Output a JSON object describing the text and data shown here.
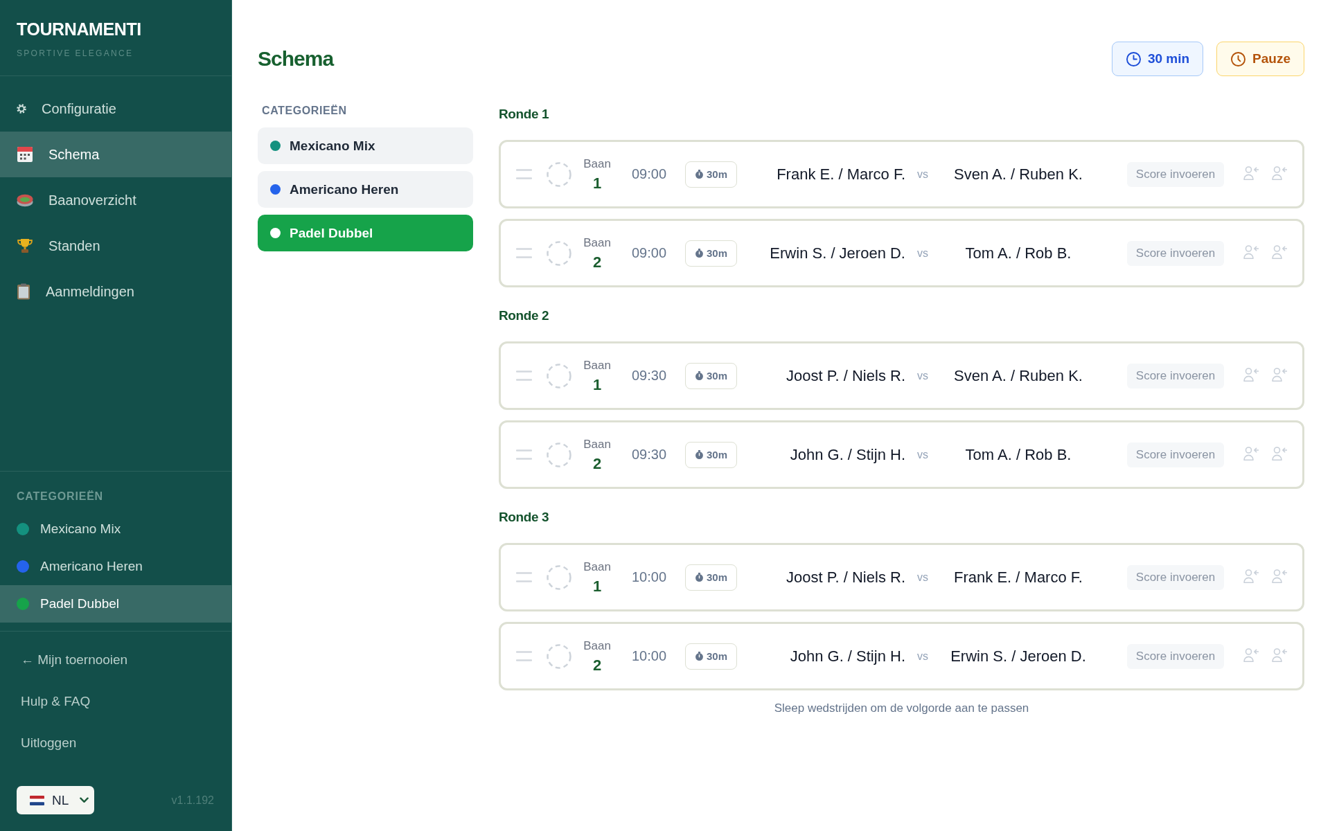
{
  "sidebar": {
    "brand": {
      "name": "TOURNAMENTI",
      "tagline": "SPORTIVE ELEGANCE"
    },
    "nav": [
      {
        "label": "Configuratie",
        "selected": false
      },
      {
        "label": "Schema",
        "selected": true
      },
      {
        "label": "Baanoverzicht",
        "selected": false
      },
      {
        "label": "Standen",
        "selected": false
      },
      {
        "label": "Aanmeldingen",
        "selected": false
      }
    ],
    "categories_heading": "CATEGORIEËN",
    "categories": [
      {
        "label": "Mexicano Mix",
        "color": "#14917f",
        "selected": false
      },
      {
        "label": "Americano Heren",
        "color": "#2563eb",
        "selected": false
      },
      {
        "label": "Padel Dubbel",
        "color": "#16a34a",
        "selected": true
      }
    ],
    "links": [
      "← Mijn toernooien",
      "Hulp & FAQ",
      "Uitloggen"
    ],
    "language": "NL",
    "version": "v1.1.192"
  },
  "header": {
    "title": "Schema",
    "buttons": [
      {
        "label": "30 min",
        "kind": "duration"
      },
      {
        "label": "Pauze",
        "kind": "pause"
      }
    ]
  },
  "category_panel": {
    "heading": "CATEGORIEËN",
    "items": [
      {
        "label": "Mexicano Mix",
        "color": "#14917f",
        "selected": false
      },
      {
        "label": "Americano Heren",
        "color": "#2563eb",
        "selected": false
      },
      {
        "label": "Padel Dubbel",
        "color": "#16a34a",
        "selected": true
      }
    ]
  },
  "rounds": [
    {
      "title": "Ronde 1",
      "matches": [
        {
          "court_label": "Baan",
          "court": "1",
          "time": "09:00",
          "duration": "30m",
          "team_1": "Frank E. / Marco F.",
          "vs": "vs",
          "team_2": "Sven A. / Ruben K.",
          "score_button": "Score invoeren"
        },
        {
          "court_label": "Baan",
          "court": "2",
          "time": "09:00",
          "duration": "30m",
          "team_1": "Erwin S. / Jeroen D.",
          "vs": "vs",
          "team_2": "Tom A. / Rob B.",
          "score_button": "Score invoeren"
        }
      ]
    },
    {
      "title": "Ronde 2",
      "matches": [
        {
          "court_label": "Baan",
          "court": "1",
          "time": "09:30",
          "duration": "30m",
          "team_1": "Joost P. / Niels R.",
          "vs": "vs",
          "team_2": "Sven A. / Ruben K.",
          "score_button": "Score invoeren"
        },
        {
          "court_label": "Baan",
          "court": "2",
          "time": "09:30",
          "duration": "30m",
          "team_1": "John G. / Stijn H.",
          "vs": "vs",
          "team_2": "Tom A. / Rob B.",
          "score_button": "Score invoeren"
        }
      ]
    },
    {
      "title": "Ronde 3",
      "matches": [
        {
          "court_label": "Baan",
          "court": "1",
          "time": "10:00",
          "duration": "30m",
          "team_1": "Joost P. / Niels R.",
          "vs": "vs",
          "team_2": "Frank E. / Marco F.",
          "score_button": "Score invoeren"
        },
        {
          "court_label": "Baan",
          "court": "2",
          "time": "10:00",
          "duration": "30m",
          "team_1": "John G. / Stijn H.",
          "vs": "vs",
          "team_2": "Erwin S. / Jeroen D.",
          "score_button": "Score invoeren"
        }
      ]
    }
  ],
  "hint": "Sleep wedstrijden om de volgorde aan te passen"
}
